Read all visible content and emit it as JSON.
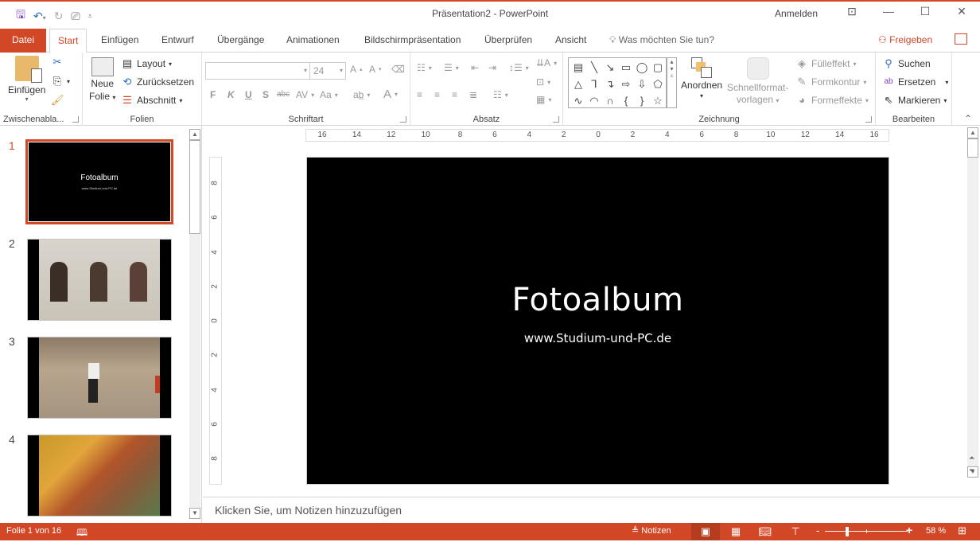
{
  "app": {
    "title": "Präsentation2  -  PowerPoint",
    "sign_in": "Anmelden",
    "accent": "#d24726"
  },
  "qat": {
    "save": "save-icon",
    "undo": "undo-icon",
    "redo": "redo-icon",
    "present": "present-from-start-icon",
    "customize": "customize-qat-icon"
  },
  "tabs": [
    {
      "label": "Datei"
    },
    {
      "label": "Start"
    },
    {
      "label": "Einfügen"
    },
    {
      "label": "Entwurf"
    },
    {
      "label": "Übergänge"
    },
    {
      "label": "Animationen"
    },
    {
      "label": "Bildschirmpräsentation"
    },
    {
      "label": "Überprüfen"
    },
    {
      "label": "Ansicht"
    }
  ],
  "tell_me": "Was möchten Sie tun?",
  "share": "Freigeben",
  "ribbon": {
    "clipboard": {
      "label": "Zwischenabla...",
      "paste": "Einfügen"
    },
    "slides": {
      "label": "Folien",
      "new_slide_1": "Neue",
      "new_slide_2": "Folie",
      "layout": "Layout",
      "reset": "Zurücksetzen",
      "section": "Abschnitt"
    },
    "font": {
      "label": "Schriftart",
      "font_name": "",
      "font_size": "24",
      "bold": "F",
      "italic": "K",
      "underline": "U",
      "shadow": "S",
      "strike": "abc",
      "spacing": "AV",
      "case": "Aa",
      "color": "A"
    },
    "paragraph": {
      "label": "Absatz"
    },
    "drawing": {
      "label": "Zeichnung",
      "arrange": "Anordnen",
      "quick_styles_1": "Schnellformat-",
      "quick_styles_2": "vorlagen",
      "fill": "Fülleffekt",
      "outline": "Formkontur",
      "effects": "Formeffekte",
      "shapes": [
        "▤",
        "╲",
        "↘",
        "▭",
        "◯",
        "▢",
        "△",
        "⅂",
        "↴",
        "⇨",
        "⇩",
        "⬠",
        "∿",
        "◠",
        "∩",
        "{",
        "}",
        "☆"
      ]
    },
    "editing": {
      "label": "Bearbeiten",
      "find": "Suchen",
      "replace": "Ersetzen",
      "select": "Markieren"
    }
  },
  "thumbnails": [
    {
      "num": "1",
      "title": "Fotoalbum",
      "sub": "www.Studium-und-PC.de",
      "selected": true
    },
    {
      "num": "2",
      "desc": "arched windows photo"
    },
    {
      "num": "3",
      "desc": "children playing football photo"
    },
    {
      "num": "4",
      "desc": "spice market photo"
    }
  ],
  "ruler": {
    "h_labels": [
      "16",
      "14",
      "12",
      "10",
      "8",
      "6",
      "4",
      "2",
      "0",
      "2",
      "4",
      "6",
      "8",
      "10",
      "12",
      "14",
      "16"
    ],
    "v_labels": [
      "8",
      "6",
      "4",
      "2",
      "0",
      "2",
      "4",
      "6",
      "8"
    ]
  },
  "slide": {
    "title": "Fotoalbum",
    "subtitle": "www.Studium-und-PC.de"
  },
  "notes": {
    "placeholder": "Klicken Sie, um Notizen hinzuzufügen"
  },
  "status": {
    "slide_info": "Folie 1 von 16",
    "notes_btn": "Notizen",
    "zoom": "58 %",
    "zoom_percent": 58
  }
}
